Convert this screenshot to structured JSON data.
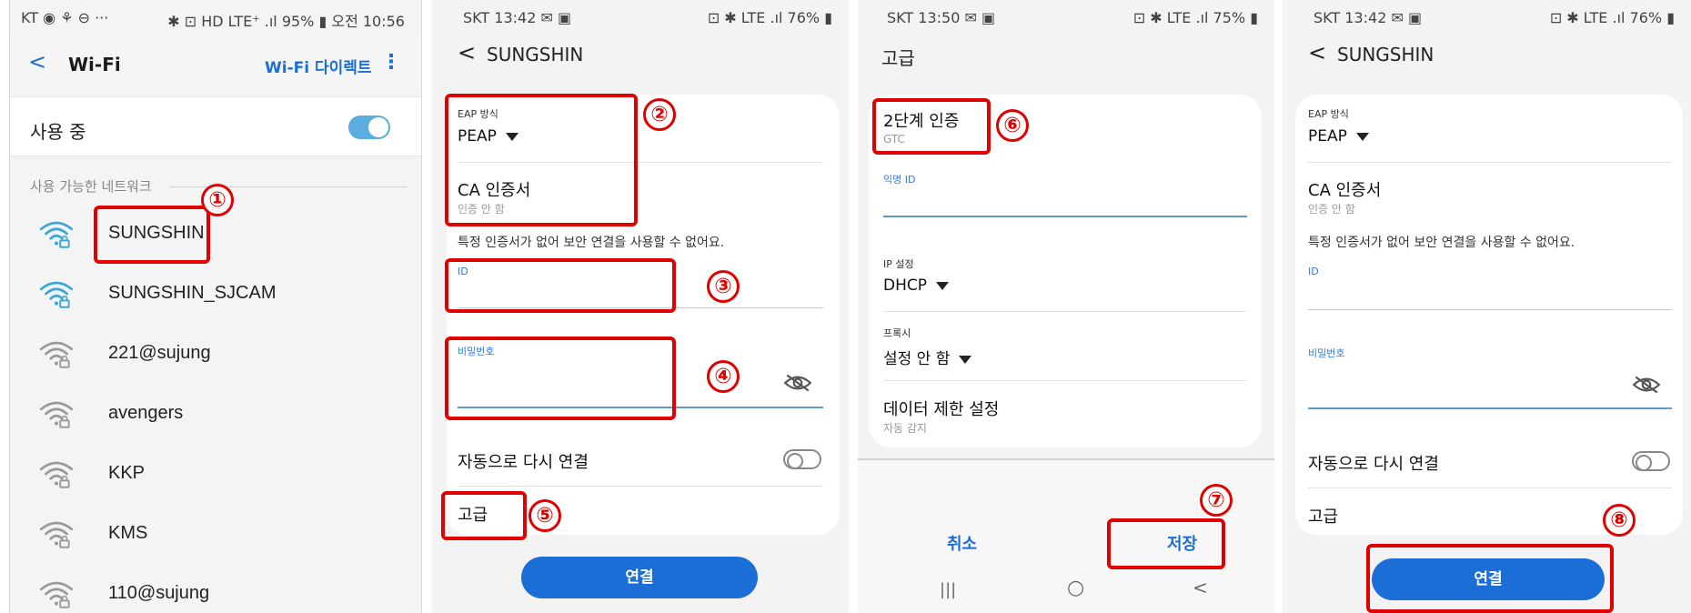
{
  "panel1": {
    "status_left": "KT ◉ ⚘ ⊖ ···",
    "status_right": "✱ ⊡ HD LTE⁺ .ıl 95% ▮ 오전 10:56",
    "back": "<",
    "title": "Wi-Fi",
    "wifi_direct": "Wi-Fi 다이렉트",
    "menu": "⋮",
    "in_use_label": "사용 중",
    "available_label": "사용 가능한 네트워크",
    "networks": [
      "SUNGSHIN",
      "SUNGSHIN_SJCAM",
      "221@sujung",
      "avengers",
      "KKP",
      "KMS",
      "110@sujung"
    ],
    "step": "①"
  },
  "panel2": {
    "status_left": "SKT 13:42 ✉ ▣",
    "status_right": "⊡ ✱ LTE .ıl 76% ▮",
    "back": "<",
    "title": "SUNGSHIN",
    "eap_label": "EAP 방식",
    "eap_value": "PEAP",
    "ca_label": "CA 인증서",
    "ca_sub": "인증 안 함",
    "warning": "특정 인증서가 없어 보안 연결을 사용할 수 없어요.",
    "id_label": "ID",
    "pw_label": "비밀번호",
    "auto_reconnect": "자동으로 다시 연결",
    "advanced": "고급",
    "connect": "연결",
    "steps": [
      "②",
      "③",
      "④",
      "⑤"
    ]
  },
  "panel3": {
    "status_left": "SKT 13:50 ✉ ▣",
    "status_right": "⊡ ✱ LTE .ıl 75% ▮",
    "title": "고급",
    "phase2_label": "2단계 인증",
    "phase2_value": "GTC",
    "anon_label": "익명 ID",
    "ip_label": "IP 설정",
    "ip_value": "DHCP",
    "proxy_label": "프록시",
    "proxy_value": "설정 안 함",
    "data_limit": "데이터 제한 설정",
    "data_limit_sub": "자동 감지",
    "cancel": "취소",
    "save": "저장",
    "nav": [
      "|||",
      "○",
      "<"
    ],
    "steps": [
      "⑥",
      "⑦"
    ]
  },
  "panel4": {
    "status_left": "SKT 13:42 ✉ ▣",
    "status_right": "⊡ ✱ LTE .ıl 76% ▮",
    "back": "<",
    "title": "SUNGSHIN",
    "eap_label": "EAP 방식",
    "eap_value": "PEAP",
    "ca_label": "CA 인증서",
    "ca_sub": "인증 안 함",
    "warning": "특정 인증서가 없어 보안 연결을 사용할 수 없어요.",
    "id_label": "ID",
    "pw_label": "비밀번호",
    "auto_reconnect": "자동으로 다시 연결",
    "advanced": "고급",
    "connect": "연결",
    "step": "⑧"
  },
  "colors": {
    "accent": "#1a6ed6",
    "annotation": "#e00000",
    "wifi": "#3aa7d6"
  }
}
